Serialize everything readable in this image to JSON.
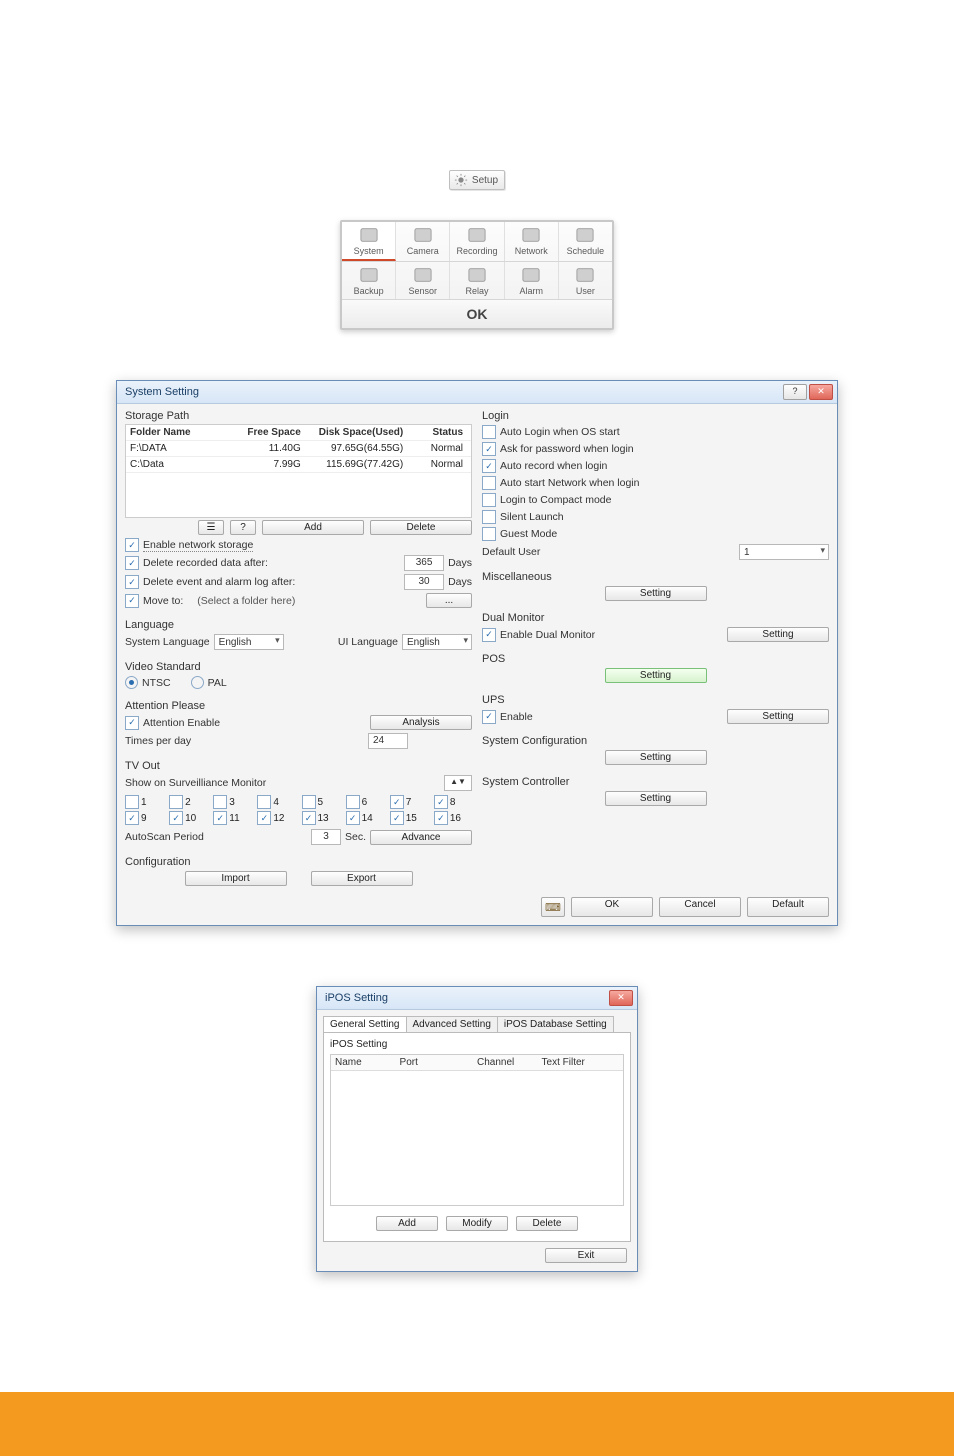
{
  "setup_button": {
    "label": "Setup"
  },
  "toolbar": {
    "row1": [
      {
        "key": "system",
        "label": "System",
        "selected": true
      },
      {
        "key": "camera",
        "label": "Camera",
        "selected": false
      },
      {
        "key": "recording",
        "label": "Recording",
        "selected": false
      },
      {
        "key": "network",
        "label": "Network",
        "selected": false
      },
      {
        "key": "schedule",
        "label": "Schedule",
        "selected": false
      }
    ],
    "row2": [
      {
        "key": "backup",
        "label": "Backup"
      },
      {
        "key": "sensor",
        "label": "Sensor"
      },
      {
        "key": "relay",
        "label": "Relay"
      },
      {
        "key": "alarm",
        "label": "Alarm"
      },
      {
        "key": "user",
        "label": "User"
      }
    ],
    "ok": "OK"
  },
  "system_dialog": {
    "title": "System Setting",
    "storage": {
      "group_title": "Storage Path",
      "columns": {
        "folder": "Folder Name",
        "free": "Free Space",
        "disk": "Disk Space(Used)",
        "status": "Status"
      },
      "rows": [
        {
          "folder": "F:\\DATA",
          "free": "11.40G",
          "disk": "97.65G(64.55G)",
          "status": "Normal"
        },
        {
          "folder": "C:\\Data",
          "free": "7.99G",
          "disk": "115.69G(77.42G)",
          "status": "Normal"
        }
      ],
      "buttons": {
        "add": "Add",
        "delete": "Delete"
      },
      "enable_network_storage": "Enable network storage",
      "delete_recorded_after_label": "Delete recorded data after:",
      "delete_recorded_after_value": "365",
      "delete_event_after_label": "Delete event and alarm log after:",
      "delete_event_after_value": "30",
      "days_label": "Days",
      "move_to_label": "Move to:",
      "move_to_value": "(Select a folder here)",
      "browse_btn": "..."
    },
    "language": {
      "group_title": "Language",
      "system_lang_label": "System Language",
      "system_lang_value": "English",
      "ui_lang_label": "UI Language",
      "ui_lang_value": "English"
    },
    "video_standard": {
      "group_title": "Video Standard",
      "ntsc": "NTSC",
      "pal": "PAL"
    },
    "attention": {
      "group_title": "Attention Please",
      "enable_label": "Attention Enable",
      "analysis_btn": "Analysis",
      "times_per_day_label": "Times per day",
      "times_per_day_value": "24"
    },
    "tvout": {
      "group_title": "TV Out",
      "show_on_label": "Show on Surveilliance Monitor",
      "channels": [
        {
          "n": "1",
          "c": false
        },
        {
          "n": "2",
          "c": false
        },
        {
          "n": "3",
          "c": false
        },
        {
          "n": "4",
          "c": false
        },
        {
          "n": "5",
          "c": false
        },
        {
          "n": "6",
          "c": false
        },
        {
          "n": "7",
          "c": true
        },
        {
          "n": "8",
          "c": true
        },
        {
          "n": "9",
          "c": true
        },
        {
          "n": "10",
          "c": true
        },
        {
          "n": "11",
          "c": true
        },
        {
          "n": "12",
          "c": true
        },
        {
          "n": "13",
          "c": true
        },
        {
          "n": "14",
          "c": true
        },
        {
          "n": "15",
          "c": true
        },
        {
          "n": "16",
          "c": true
        }
      ],
      "autoscan_label": "AutoScan Period",
      "autoscan_value": "3",
      "sec_label": "Sec.",
      "advance_btn": "Advance"
    },
    "configuration": {
      "group_title": "Configuration",
      "import": "Import",
      "export": "Export"
    },
    "login": {
      "group_title": "Login",
      "auto_login_label": "Auto Login when OS start",
      "ask_password_label": "Ask for password when login",
      "auto_record_label": "Auto record when login",
      "auto_network_label": "Auto start Network when login",
      "compact_label": "Login to Compact mode",
      "silent_label": "Silent Launch",
      "guest_label": "Guest Mode",
      "default_user_label": "Default User",
      "default_user_value": "1"
    },
    "misc": {
      "group_title": "Miscellaneous",
      "setting_btn": "Setting"
    },
    "dual_monitor": {
      "group_title": "Dual Monitor",
      "enable_label": "Enable Dual Monitor",
      "setting_btn": "Setting"
    },
    "pos": {
      "group_title": "POS",
      "setting_btn": "Setting"
    },
    "ups": {
      "group_title": "UPS",
      "enable_label": "Enable",
      "setting_btn": "Setting"
    },
    "sys_cfg": {
      "group_title": "System Configuration",
      "setting_btn": "Setting"
    },
    "sys_ctrl": {
      "group_title": "System Controller",
      "setting_btn": "Setting"
    },
    "footer_buttons": {
      "ok": "OK",
      "cancel": "Cancel",
      "default": "Default"
    }
  },
  "ipos_dialog": {
    "title": "iPOS Setting",
    "tabs": {
      "general": "General Setting",
      "advanced": "Advanced Setting",
      "db": "iPOS Database Setting"
    },
    "inner_title": "iPOS Setting",
    "columns": {
      "name": "Name",
      "port": "Port",
      "channel": "Channel",
      "filter": "Text Filter"
    },
    "buttons": {
      "add": "Add",
      "modify": "Modify",
      "delete": "Delete",
      "exit": "Exit"
    }
  }
}
